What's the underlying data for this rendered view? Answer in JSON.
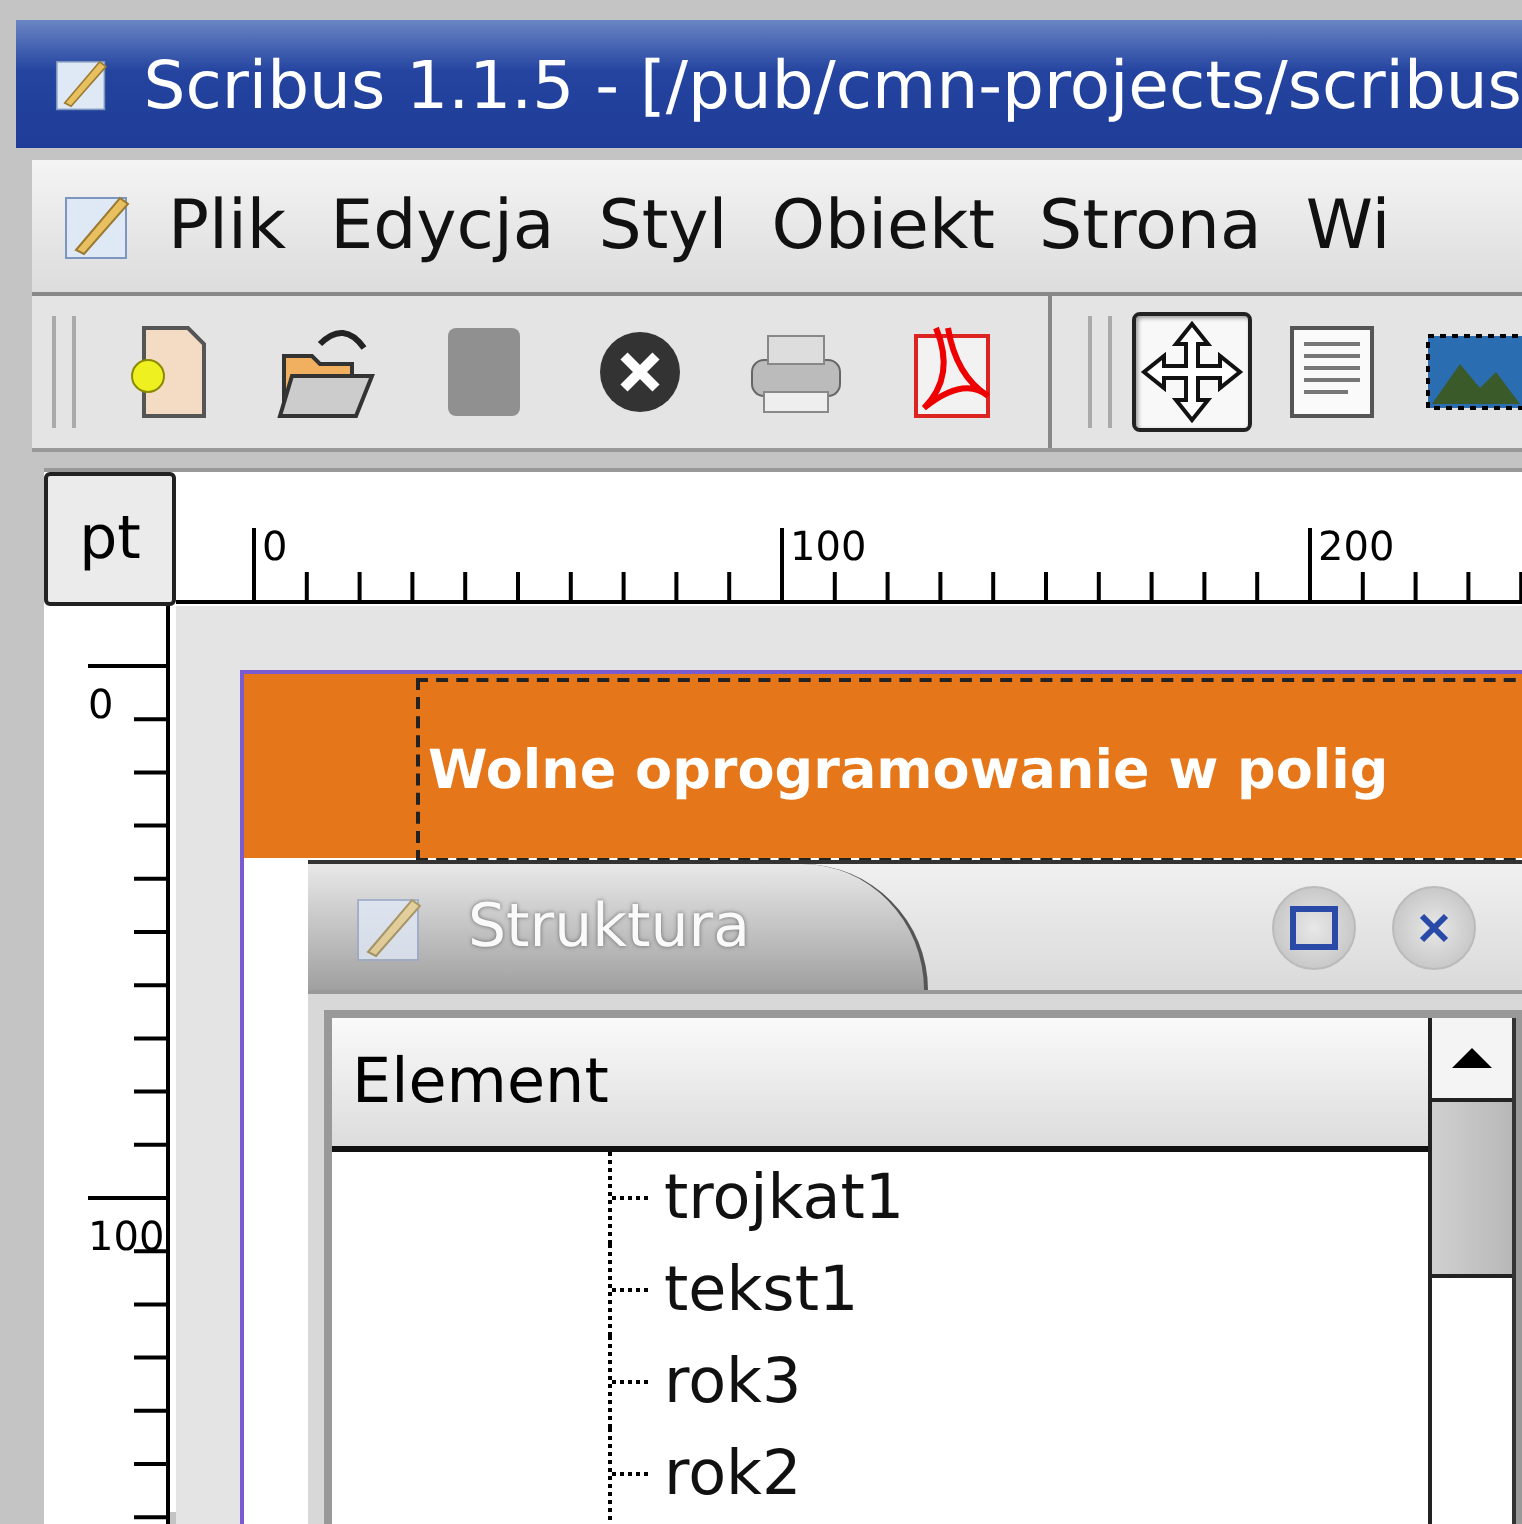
{
  "window": {
    "title": "Scribus 1.1.5 - [/pub/cmn-projects/scribus"
  },
  "menu": [
    "Plik",
    "Edycja",
    "Styl",
    "Obiekt",
    "Strona",
    "Wi"
  ],
  "toolbar": {
    "file_buttons": [
      {
        "disabled": false
      },
      {
        "disabled": false
      },
      {
        "disabled": true
      },
      {
        "disabled": false
      },
      {
        "disabled": false
      },
      {
        "disabled": false
      }
    ],
    "mode_buttons": [
      {
        "selected": true
      },
      {
        "selected": false
      },
      {
        "selected": false
      }
    ]
  },
  "ruler": {
    "unit": "pt",
    "x_labels": [
      "0",
      "100",
      "200"
    ],
    "y_labels": [
      "0",
      "100"
    ]
  },
  "page": {
    "headline": "Wolne oprogramowanie w polig"
  },
  "structure_panel": {
    "title": "Struktura",
    "column": "Element",
    "items": [
      "trojkat1",
      "tekst1",
      "rok3",
      "rok2"
    ]
  }
}
